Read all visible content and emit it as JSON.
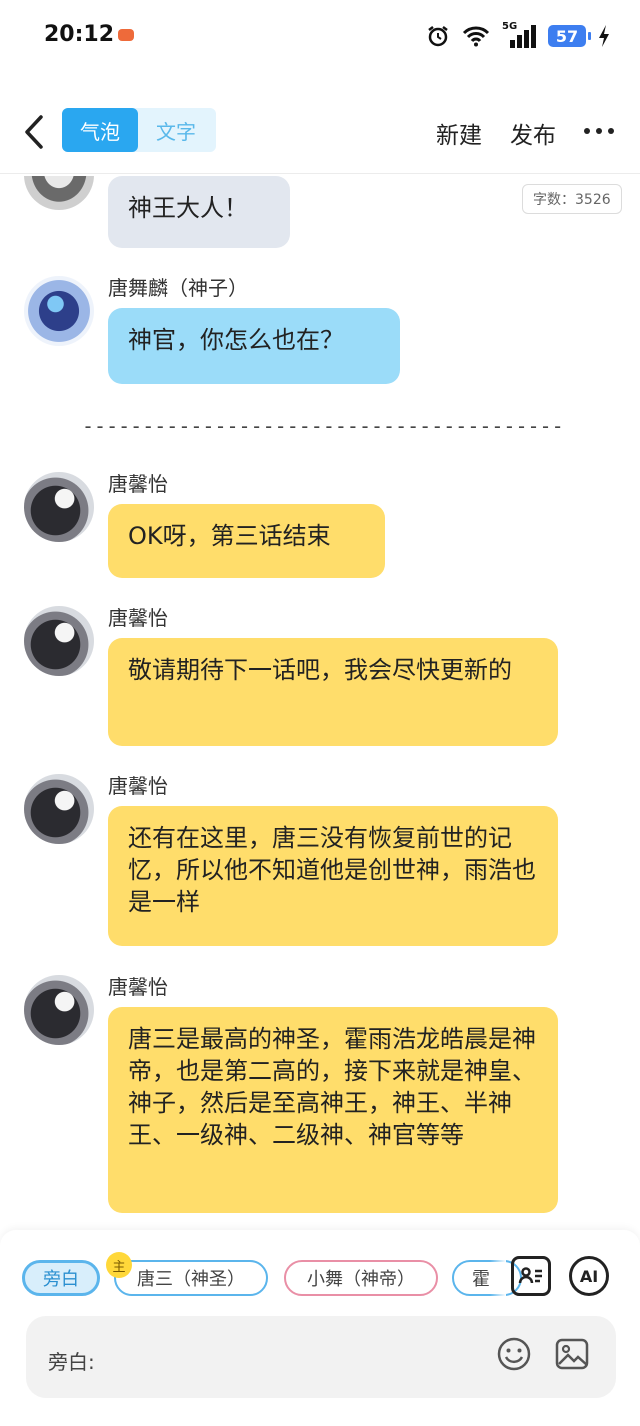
{
  "status_bar": {
    "time": "20:12",
    "battery": "57",
    "signal_label": "5G"
  },
  "nav": {
    "modes": [
      "气泡",
      "文字"
    ],
    "new_label": "新建",
    "publish_label": "发布"
  },
  "word_count": "字数：3526",
  "messages": [
    {
      "sender": "",
      "text": "神王大人！",
      "style": "gray"
    },
    {
      "sender": "唐舞麟（神子）",
      "text": "神官，你怎么也在？",
      "style": "blue"
    },
    {
      "sender": "唐馨怡",
      "text": "OK呀，第三话结束",
      "style": "yellow"
    },
    {
      "sender": "唐馨怡",
      "text": "敬请期待下一话吧，我会尽快更新的",
      "style": "yellow"
    },
    {
      "sender": "唐馨怡",
      "text": "还有在这里，唐三没有恢复前世的记忆，所以他不知道他是创世神，雨浩也是一样",
      "style": "yellow"
    },
    {
      "sender": "唐馨怡",
      "text": "唐三是最高的神圣，霍雨浩龙皓晨是神帝，也是第二高的，接下来就是神皇、神子，然后是至高神王，神王、半神王、一级神、二级神、神官等等",
      "style": "yellow"
    }
  ],
  "divider": "----------------------------------------",
  "bottom": {
    "chips": [
      "旁白",
      "唐三（神圣）",
      "小舞（神帝）",
      "霍"
    ],
    "main_badge": "主",
    "ai_label": "AI",
    "input_label": "旁白:"
  },
  "colors": {
    "accent": "#2aa7f0",
    "bubble_yellow": "#ffdd6b",
    "bubble_blue": "#9bdcf9",
    "bubble_gray": "#e2e7ef"
  }
}
